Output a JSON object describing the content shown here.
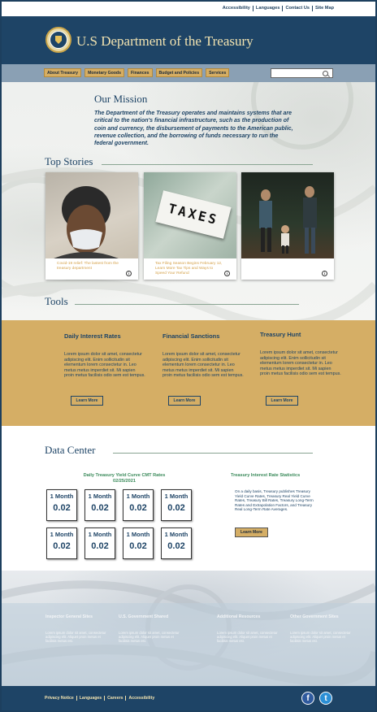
{
  "util_links": [
    "Accessibility",
    "Languages",
    "Contact Us",
    "Site Map"
  ],
  "header": {
    "title": "U.S Department of the Treasury"
  },
  "nav": {
    "items": [
      "About Treasury",
      "Monetary Goods",
      "Finances",
      "Budget and Policies",
      "Services"
    ],
    "search_placeholder": ""
  },
  "mission": {
    "title": "Our Mission",
    "text": "The Department of the Treasury operates and maintains systems that are critical to the nation's financial infrastructure, such as the production of coin and currency, the disbursement of payments to the American public, revenue collection, and the borrowing of funds necessary to run the federal government."
  },
  "top_stories": {
    "title": "Top Stories",
    "items": [
      {
        "caption": "Covid-19 relief: The lastest from the treasury department"
      },
      {
        "caption": "Tax Filing Season Begins February 12, Learn More Tax Tips and Ways to Speed Your Refund",
        "image_text": "TAXES"
      },
      {
        "caption": ""
      }
    ]
  },
  "tools": {
    "title": "Tools",
    "items": [
      {
        "title": "Daily Interest Rates",
        "text": "Lorem ipsum dolor sit amet, consectetur adipiscing elit. Enim sollicitudin sit elementum lorem consectetur in. Leo metus metus imperdiet sit. Mi sapien proin metus facilisis odio sem est tempus.",
        "button": "Learn More"
      },
      {
        "title": "Financial Sanctions",
        "text": "Lorem ipsum dolor sit amet, consectetur adipiscing elit. Enim sollicitudin sit elementum lorem consectetur in. Leo metus metus imperdiet sit. Mi sapien proin metus facilisis odio sem est tempus.",
        "button": "Learn More"
      },
      {
        "title": "Treasury Hunt",
        "text": "Lorem ipsum dolor sit amet, consectetur adipiscing elit. Enim sollicitudin sit elementum lorem consectetur in. Leo metus metus imperdiet sit. Mi sapien proin metus facilisis odio sem est tempus.",
        "button": "Learn More"
      }
    ]
  },
  "data_center": {
    "title": "Data Center",
    "yield_title": "Daily Treasury Yield Curve CMT Rates",
    "yield_date": "02/25/2021",
    "rates": [
      {
        "label": "1 Month",
        "value": "0.02"
      },
      {
        "label": "1 Month",
        "value": "0.02"
      },
      {
        "label": "1 Month",
        "value": "0.02"
      },
      {
        "label": "1 Month",
        "value": "0.02"
      },
      {
        "label": "1 Month",
        "value": "0.02"
      },
      {
        "label": "1 Month",
        "value": "0.02"
      },
      {
        "label": "1 Month",
        "value": "0.02"
      },
      {
        "label": "1 Month",
        "value": "0.02"
      }
    ],
    "stats_title": "Treasury Interest Rate Statistics",
    "stats_text": "On a daily basis, Treasury publishes Treasury Yield Curve Rates, Treasury Real Yield Curve Rates, Treasury Bill Rates, Treasury Long-Term Rates and Extrapolation Factors, and Treasury Real Long-Term Rate Averages.",
    "stats_button": "Learn More"
  },
  "footer_columns": [
    {
      "title": "Inspector General Sites",
      "text": "Lorem ipsum dolor sit amet, consectetur adipiscing elit. Aliquet proin metus et facilisis metus est."
    },
    {
      "title": "U.S. Government Shared",
      "text": "Lorem ipsum dolor sit amet, consectetur adipiscing elit. Aliquet proin metus et facilisis metus est."
    },
    {
      "title": "Additional Resources",
      "text": "Lorem ipsum dolor sit amet, consectetur adipiscing elit. Aliquet proin metus et facilisis metus est."
    },
    {
      "title": "Other Government Sites",
      "text": "Lorem ipsum dolor sit amet, consectetur adipiscing elit. Aliquet proin metus et facilisis metus est."
    }
  ],
  "bottom_links": [
    "Privacy Notice",
    "Languages",
    "Careers",
    "Accessibility"
  ],
  "social": [
    {
      "icon": "facebook-icon",
      "glyph": "f"
    },
    {
      "icon": "twitter-icon",
      "glyph": "t"
    }
  ],
  "colors": {
    "navy": "#1e4466",
    "gold": "#d5ae65",
    "green": "#3a8a5a",
    "nav_gray": "#8aa0b4"
  }
}
